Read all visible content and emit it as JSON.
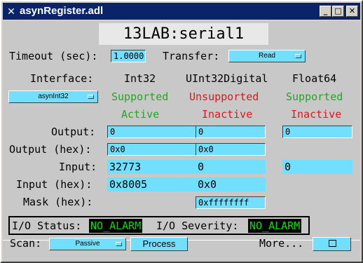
{
  "window": {
    "title": "asynRegister.adl",
    "minimize": "_",
    "maximize": "□",
    "close": "✕"
  },
  "header": {
    "device": "13LAB:serial1"
  },
  "timeout": {
    "label": "Timeout (sec):",
    "value": "1.0000"
  },
  "transfer": {
    "label": "Transfer:",
    "value": "Read"
  },
  "interface": {
    "label": "Interface:",
    "value": "asynInt32"
  },
  "columns": [
    {
      "name": "Int32",
      "support": "Supported",
      "state": "Active"
    },
    {
      "name": "UInt32Digital",
      "support": "Unsupported",
      "state": "Inactive"
    },
    {
      "name": "Float64",
      "support": "Supported",
      "state": "Inactive"
    }
  ],
  "rows": {
    "output": {
      "label": "Output:",
      "int32": "0",
      "uint32": "0",
      "float64": "0"
    },
    "output_hex": {
      "label": "Output (hex):",
      "int32": "0x0",
      "uint32": "0x0"
    },
    "input": {
      "label": "Input:",
      "int32": "32773",
      "uint32": "0",
      "float64": "0"
    },
    "input_hex": {
      "label": "Input (hex):",
      "int32": "0x8005",
      "uint32": "0x0"
    },
    "mask_hex": {
      "label": "Mask (hex):",
      "uint32": "0xffffffff"
    }
  },
  "status": {
    "io_status_label": "I/O Status:",
    "io_status": "NO_ALARM",
    "io_severity_label": "I/O Severity:",
    "io_severity": "NO_ALARM"
  },
  "footer": {
    "scan_label": "Scan:",
    "scan_value": "Passive",
    "process_label": "Process",
    "more_label": "More..."
  },
  "colors": {
    "widget_bg": "#73dfff",
    "supported": "#21a821",
    "unsupported": "#df1717",
    "alarm_ok": "#00e000"
  }
}
